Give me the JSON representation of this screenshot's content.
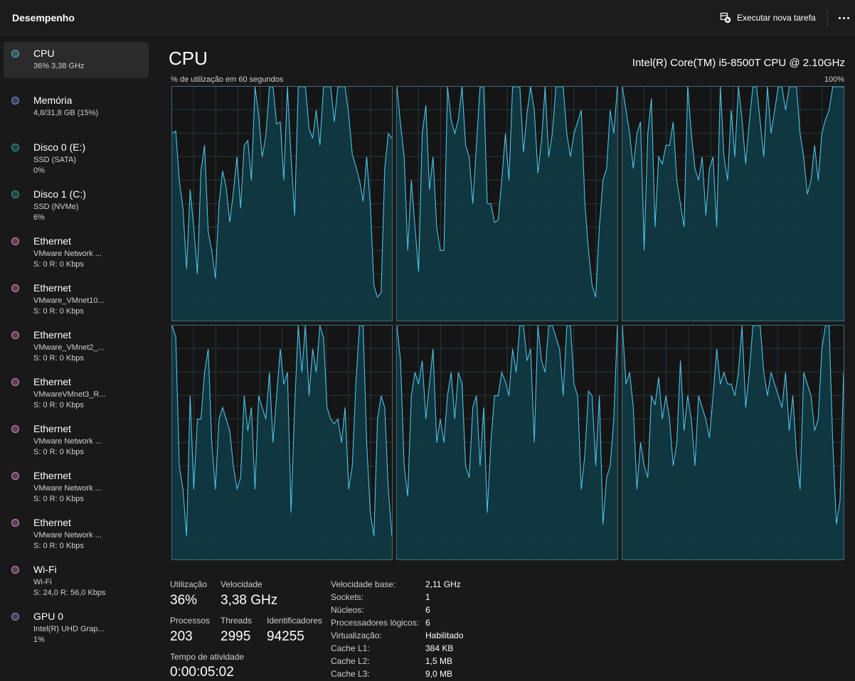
{
  "header": {
    "title": "Desempenho",
    "run_task_label": "Executar nova tarefa"
  },
  "sidebar": {
    "items": [
      {
        "name": "CPU",
        "sub1": "36% 3,38 GHz",
        "sub2": "",
        "dot_color": "#4fb0c6",
        "selected": true
      },
      {
        "name": "Memória",
        "sub1": "4,8/31,8 GB (15%)",
        "sub2": "",
        "dot_color": "#7f8fe0"
      },
      {
        "name": "Disco 0 (E:)",
        "sub1": "SSD (SATA)",
        "sub2": "0%",
        "dot_color": "#2e9e8c"
      },
      {
        "name": "Disco 1 (C:)",
        "sub1": "SSD (NVMe)",
        "sub2": "6%",
        "dot_color": "#2e9e8c"
      },
      {
        "name": "Ethernet",
        "sub1": "VMware Network ...",
        "sub2": "S: 0 R: 0 Kbps",
        "dot_color": "#d98cc0"
      },
      {
        "name": "Ethernet",
        "sub1": "VMware_VMnet10...",
        "sub2": "S: 0 R: 0 Kbps",
        "dot_color": "#d98cc0"
      },
      {
        "name": "Ethernet",
        "sub1": "VMware_VMnet2_...",
        "sub2": "S: 0 R: 0 Kbps",
        "dot_color": "#d98cc0"
      },
      {
        "name": "Ethernet",
        "sub1": "VMwareVMnet3_R...",
        "sub2": "S: 0 R: 0 Kbps",
        "dot_color": "#d98cc0"
      },
      {
        "name": "Ethernet",
        "sub1": "VMware Network ...",
        "sub2": "S: 0 R: 0 Kbps",
        "dot_color": "#d98cc0"
      },
      {
        "name": "Ethernet",
        "sub1": "VMware Network ...",
        "sub2": "S: 0 R: 0 Kbps",
        "dot_color": "#d98cc0"
      },
      {
        "name": "Ethernet",
        "sub1": "VMware Network ...",
        "sub2": "S: 0 R: 0 Kbps",
        "dot_color": "#d98cc0"
      },
      {
        "name": "Wi-Fi",
        "sub1": "Wi-Fi",
        "sub2": "S: 24,0 R: 56,0 Kbps",
        "dot_color": "#d98cc0"
      },
      {
        "name": "GPU 0",
        "sub1": "Intel(R) UHD Grap...",
        "sub2": "1%",
        "dot_color": "#9c8cd6"
      }
    ]
  },
  "main": {
    "title": "CPU",
    "model": "Intel(R) Core(TM) i5-8500T CPU @ 2.10GHz",
    "graph_caption": "% de utilização em 60 segundos",
    "graph_max": "100%",
    "line_color": "#4fc3e6",
    "fill_color": "#0f3a44"
  },
  "chart_data": {
    "type": "area",
    "title": "",
    "xlabel": "",
    "ylabel": "% de utilização em 60 segundos",
    "ylim": [
      0,
      100
    ],
    "xlim": [
      0,
      60
    ],
    "grid": true,
    "series": [
      {
        "values": [
          80,
          81,
          60,
          48,
          22,
          56,
          40,
          20,
          64,
          75,
          38,
          30,
          18,
          50,
          64,
          57,
          42,
          55,
          70,
          48,
          75,
          77,
          60,
          100,
          88,
          70,
          79,
          100,
          100,
          84,
          85,
          60,
          100,
          70,
          45,
          100,
          100,
          100,
          82,
          78,
          90,
          75,
          100,
          100,
          100,
          85,
          100,
          100,
          100,
          88,
          71,
          66,
          60,
          51,
          70,
          50,
          15,
          10,
          12,
          65,
          80,
          78
        ]
      },
      {
        "values": [
          100,
          84,
          70,
          30,
          60,
          40,
          21,
          80,
          92,
          56,
          70,
          40,
          30,
          30,
          100,
          86,
          80,
          86,
          100,
          75,
          70,
          50,
          75,
          100,
          100,
          50,
          50,
          42,
          43,
          60,
          80,
          60,
          100,
          100,
          100,
          72,
          89,
          100,
          90,
          63,
          77,
          100,
          70,
          80,
          100,
          100,
          100,
          80,
          70,
          80,
          85,
          90,
          50,
          30,
          15,
          10,
          40,
          60,
          65,
          90,
          80,
          100
        ]
      },
      {
        "values": [
          100,
          90,
          80,
          65,
          80,
          85,
          30,
          80,
          95,
          40,
          70,
          67,
          75,
          75,
          85,
          60,
          50,
          40,
          100,
          80,
          65,
          60,
          70,
          45,
          65,
          70,
          40,
          100,
          70,
          60,
          90,
          70,
          100,
          86,
          67,
          85,
          100,
          100,
          85,
          70,
          100,
          80,
          90,
          100,
          100,
          90,
          100,
          100,
          100,
          80,
          70,
          54,
          60,
          75,
          60,
          80,
          86,
          90,
          100,
          100,
          100,
          100
        ]
      },
      {
        "values": [
          100,
          95,
          40,
          30,
          10,
          70,
          30,
          60,
          60,
          80,
          90,
          50,
          30,
          60,
          65,
          60,
          55,
          40,
          30,
          35,
          70,
          55,
          65,
          30,
          70,
          65,
          60,
          80,
          50,
          70,
          90,
          75,
          80,
          20,
          65,
          100,
          80,
          100,
          70,
          90,
          80,
          100,
          95,
          65,
          60,
          58,
          60,
          50,
          65,
          30,
          40,
          75,
          100,
          100,
          50,
          20,
          10,
          60,
          70,
          65,
          30,
          10
        ]
      },
      {
        "values": [
          100,
          85,
          40,
          27,
          70,
          80,
          75,
          85,
          60,
          75,
          90,
          50,
          60,
          50,
          70,
          80,
          60,
          80,
          75,
          40,
          35,
          65,
          70,
          40,
          65,
          20,
          50,
          70,
          70,
          80,
          76,
          70,
          90,
          80,
          100,
          100,
          85,
          90,
          50,
          100,
          85,
          80,
          100,
          100,
          95,
          90,
          70,
          100,
          100,
          75,
          70,
          30,
          45,
          72,
          70,
          40,
          70,
          15,
          35,
          40,
          60,
          100
        ]
      },
      {
        "values": [
          100,
          75,
          80,
          65,
          30,
          50,
          40,
          35,
          70,
          66,
          78,
          60,
          70,
          60,
          40,
          50,
          85,
          55,
          70,
          60,
          40,
          70,
          65,
          60,
          52,
          70,
          90,
          75,
          80,
          75,
          75,
          70,
          80,
          100,
          65,
          80,
          100,
          100,
          100,
          80,
          70,
          80,
          75,
          70,
          65,
          80,
          55,
          70,
          45,
          30,
          80,
          75,
          70,
          55,
          60,
          90,
          100,
          100,
          50,
          15,
          25,
          80
        ]
      }
    ]
  },
  "stats": {
    "utilization_label": "Utilização",
    "utilization_value": "36%",
    "speed_label": "Velocidade",
    "speed_value": "3,38 GHz",
    "processes_label": "Processos",
    "processes_value": "203",
    "threads_label": "Threads",
    "threads_value": "2995",
    "handles_label": "Identificadores",
    "handles_value": "94255",
    "uptime_label": "Tempo de atividade",
    "uptime_value": "0:00:05:02"
  },
  "specs": [
    {
      "label": "Velocidade base:",
      "value": "2,11 GHz"
    },
    {
      "label": "Sockets:",
      "value": "1"
    },
    {
      "label": "Núcleos:",
      "value": "6"
    },
    {
      "label": "Processadores lógicos:",
      "value": "6"
    },
    {
      "label": "Virtualização:",
      "value": "Habilitado"
    },
    {
      "label": "Cache L1:",
      "value": "384 KB"
    },
    {
      "label": "Cache L2:",
      "value": "1,5 MB"
    },
    {
      "label": "Cache L3:",
      "value": "9,0 MB"
    }
  ]
}
